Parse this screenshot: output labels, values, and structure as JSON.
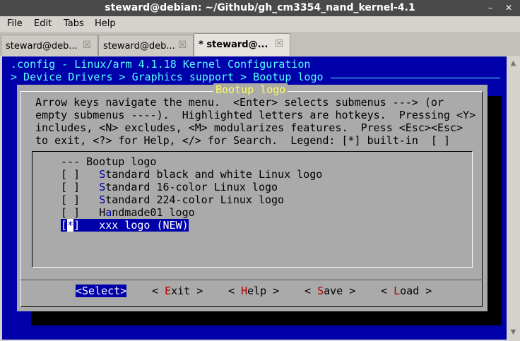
{
  "window": {
    "title": "steward@debian: ~/Github/gh_cm3354_nand_kernel-4.1",
    "menu": [
      "File",
      "Edit",
      "Tabs",
      "Help"
    ]
  },
  "tabs": [
    {
      "label": "steward@deb..."
    },
    {
      "label": "steward@deb..."
    },
    {
      "label": "* steward@..."
    }
  ],
  "kconfig": {
    "config_line": ".config - Linux/arm 4.1.18 Kernel Configuration",
    "breadcrumb": "> Device Drivers > Graphics support > Bootup logo",
    "dialog_title": "Bootup logo",
    "help_lines": [
      "Arrow keys navigate the menu.  <Enter> selects submenus ---> (or",
      "empty submenus ----).  Highlighted letters are hotkeys.  Pressing <Y>",
      "includes, <N> excludes, <M> modularizes features.  Press <Esc><Esc>",
      "to exit, <?> for Help, </> for Search.  Legend: [*] built-in  [ ]"
    ],
    "menu_header": "--- Bootup logo",
    "items": [
      {
        "box": "[ ]",
        "hotkey": "S",
        "rest": "tandard black and white Linux logo"
      },
      {
        "box": "[ ]",
        "hotkey": "S",
        "rest": "tandard 16-color Linux logo"
      },
      {
        "box": "[ ]",
        "hotkey": "S",
        "rest": "tandard 224-color Linux logo"
      },
      {
        "box": "[ ]",
        "prefix": "H",
        "hotkey": "a",
        "rest": "ndmade01 logo"
      },
      {
        "box_left": "[",
        "box_mark": "*",
        "box_right": "]",
        "text": "xxx logo (NEW)"
      }
    ],
    "buttons": {
      "select": "<Select>",
      "exit_l": "< ",
      "exit_k": "E",
      "exit_r": "xit >",
      "help_l": "< ",
      "help_k": "H",
      "help_r": "elp >",
      "save_l": "< ",
      "save_k": "S",
      "save_r": "ave >",
      "load_l": "< ",
      "load_k": "L",
      "load_r": "oad >"
    }
  }
}
